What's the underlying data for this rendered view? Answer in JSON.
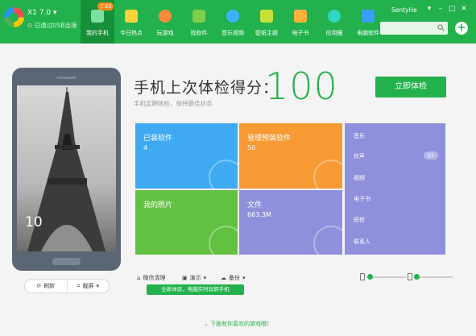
{
  "app": {
    "version": "X1 7.0",
    "connection_status": "已通过USB连接"
  },
  "nav": {
    "items": [
      {
        "label": "我的手机",
        "active": true,
        "badge": "7.16",
        "color": "#7ee0a0"
      },
      {
        "label": "今日热点",
        "color": "#ffd23a"
      },
      {
        "label": "玩游戏",
        "color": "#ff8a3d"
      },
      {
        "label": "找软件",
        "color": "#7ecf4a"
      },
      {
        "label": "音乐视频",
        "color": "#3fb2ff"
      },
      {
        "label": "壁纸主题",
        "color": "#c6e03a"
      },
      {
        "label": "电子书",
        "color": "#ffb23a"
      },
      {
        "label": "应用圈",
        "color": "#2fd6c0"
      },
      {
        "label": "电脑软件",
        "color": "#3aa0ff"
      }
    ]
  },
  "header": {
    "user": "SentyHe",
    "minimize": "–",
    "maximize": "□",
    "close": "✕",
    "plus": "+"
  },
  "phone": {
    "clock": "10",
    "refresh_label": "刷新",
    "screenshot_label": "截屏"
  },
  "score": {
    "title": "手机上次体检得分：",
    "subtitle": "手机定期体检，保持最佳状态",
    "value": "100",
    "button": "立即体检"
  },
  "tiles": [
    {
      "title": "已装软件",
      "value": "4",
      "color": "#3eaaf1"
    },
    {
      "title": "管理预装软件",
      "value": "50",
      "color": "#f79a33"
    },
    {
      "title": "我的照片",
      "value": "",
      "color": "#62c140"
    },
    {
      "title": "文件",
      "value": "663.3M",
      "color": "#8f90dc"
    }
  ],
  "list": {
    "items": [
      "音乐",
      "铃声",
      "视频",
      "电子书",
      "短信",
      "联系人"
    ],
    "ringtone_badge": "51"
  },
  "toolbar": {
    "wechat": "微信清理",
    "demo": "演示",
    "backup": "备份",
    "promo": "全新体验，电脑实时玩转手机"
  },
  "footer": {
    "text": "下面有你喜欢的游戏哦！"
  },
  "colors": {
    "brand": "#22b14c",
    "brand_dark": "#17903a"
  }
}
